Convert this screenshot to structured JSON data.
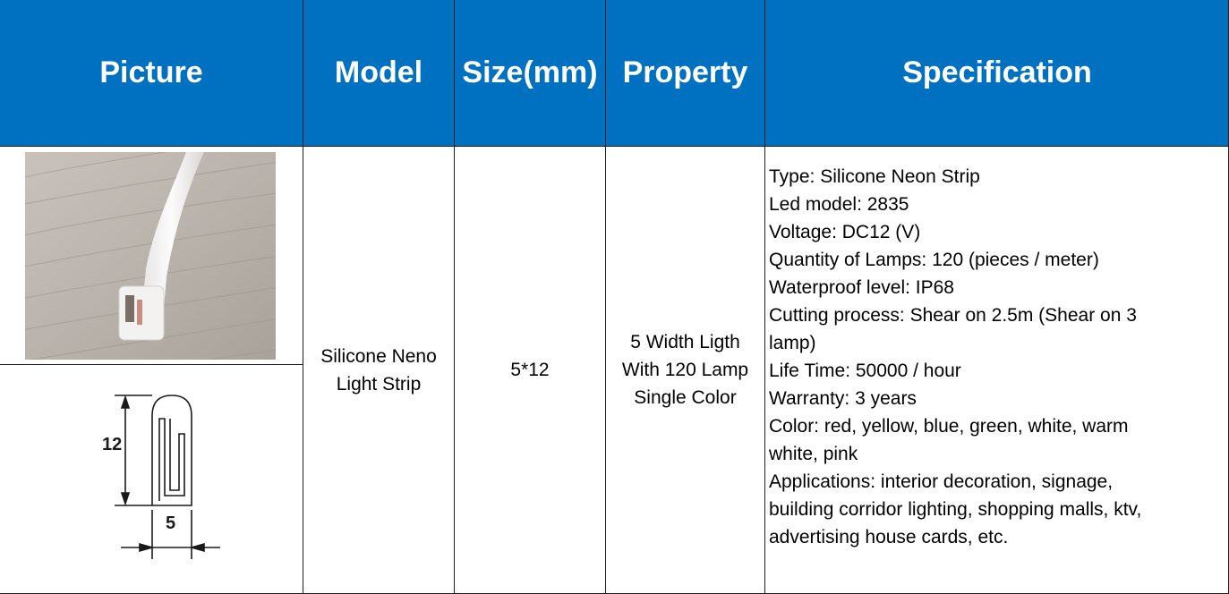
{
  "header": {
    "picture": "Picture",
    "model": "Model",
    "size": "Size(mm)",
    "property": "Property",
    "specification": "Specification"
  },
  "row": {
    "model": [
      "Silicone Neno",
      "Light Strip"
    ],
    "size": "5*12",
    "property": [
      "5 Width Ligth",
      "With 120 Lamp",
      "Single Color"
    ],
    "spec_lines": [
      "Type: Silicone Neon Strip",
      "Led model: 2835",
      "Voltage: DC12 (V)",
      "Quantity of Lamps: 120 (pieces / meter)",
      "Waterproof level: IP68",
      "Cutting process: Shear on 2.5m (Shear on 3",
      "lamp)",
      "Life Time: 50000 / hour",
      "Warranty: 3 years",
      "Color: red, yellow, blue, green, white, warm",
      "white, pink",
      "Applications: interior decoration, signage,",
      "building corridor lighting, shopping malls, ktv,",
      "advertising house cards, etc."
    ]
  },
  "diagram": {
    "height_label": "12",
    "width_label": "5"
  },
  "colors": {
    "header_bg": "#0070c0",
    "header_text": "#ffffff",
    "grid": "#1f1f1f"
  }
}
